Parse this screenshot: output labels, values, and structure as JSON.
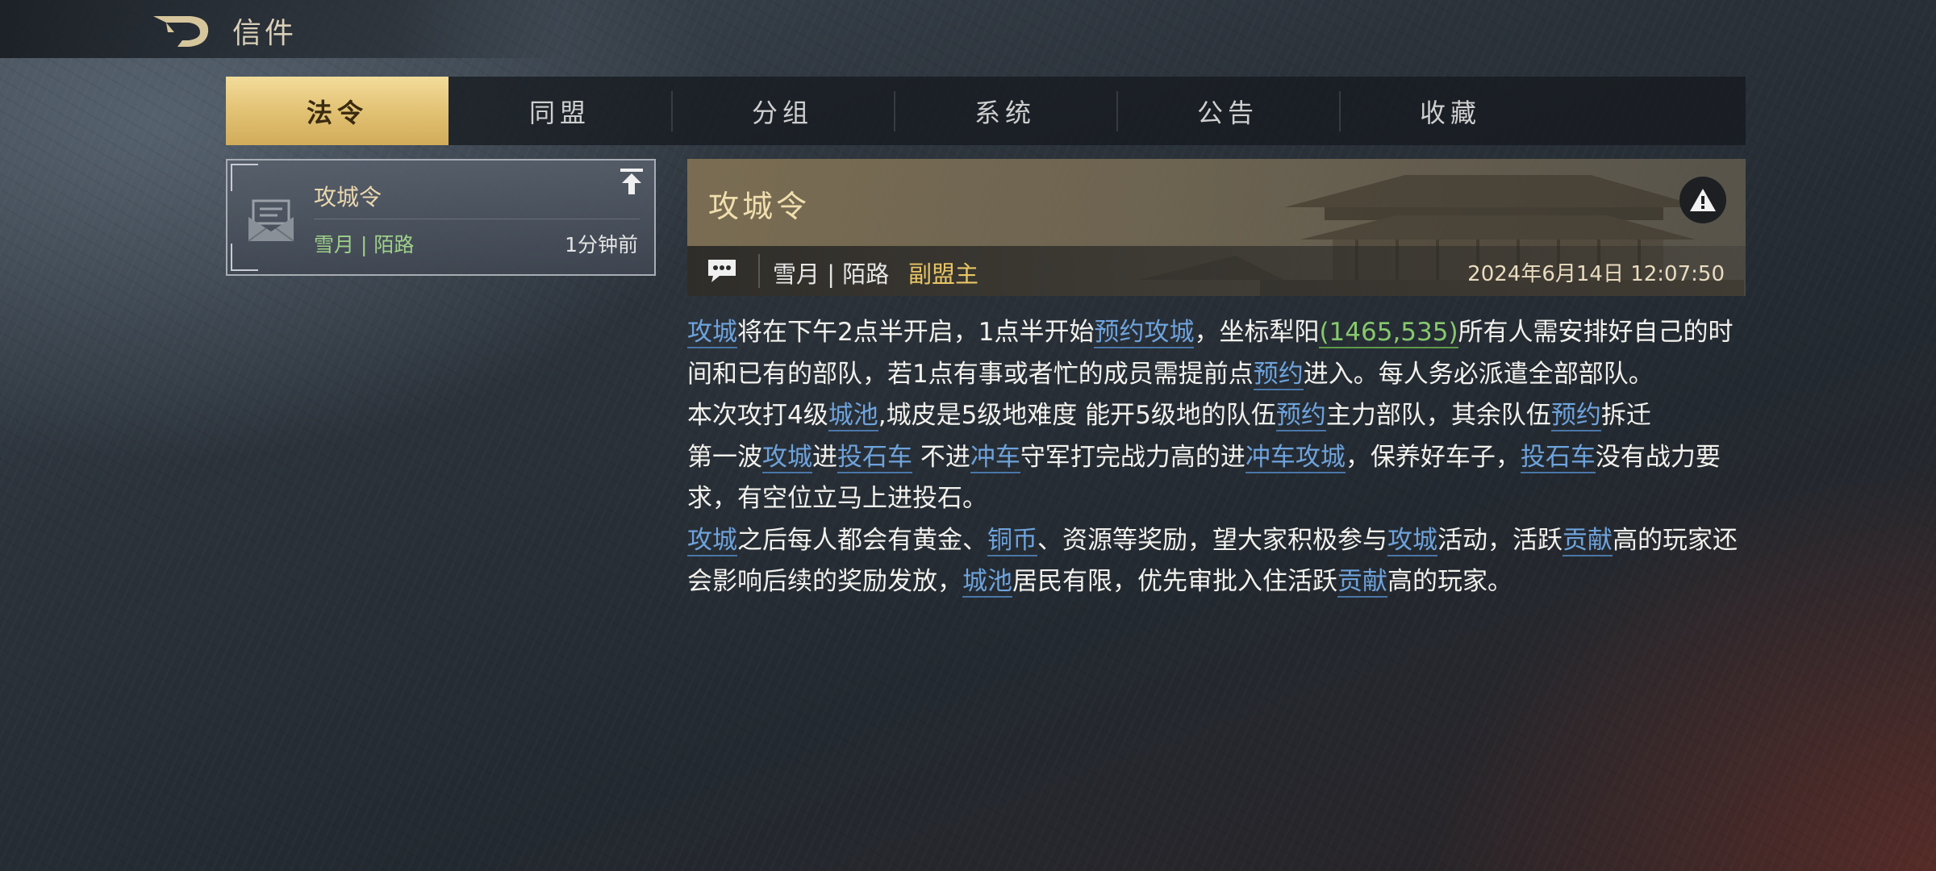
{
  "header": {
    "title": "信件"
  },
  "tabs": [
    {
      "label": "法令",
      "active": true
    },
    {
      "label": "同盟",
      "active": false
    },
    {
      "label": "分组",
      "active": false
    },
    {
      "label": "系统",
      "active": false
    },
    {
      "label": "公告",
      "active": false
    },
    {
      "label": "收藏",
      "active": false
    }
  ],
  "mail_list": [
    {
      "title": "攻城令",
      "sender": "雪月 | 陌路",
      "time": "1分钟前",
      "icon": "envelope-icon",
      "pinned": true
    }
  ],
  "detail": {
    "title": "攻城令",
    "sender": "雪月 | 陌路",
    "role": "副盟主",
    "datetime": "2024年6月14日 12:07:50",
    "paragraphs": [
      [
        {
          "t": "攻城",
          "k": "kw"
        },
        {
          "t": "将在下午2点半开启，1点半开始"
        },
        {
          "t": "预约攻城",
          "k": "kw"
        },
        {
          "t": "，坐标犁阳"
        },
        {
          "t": "(1465,535)",
          "k": "coord"
        },
        {
          "t": "所有人需安排好自己的时间和已有的部队，若1点有事或者忙的成员需提前点"
        },
        {
          "t": "预约",
          "k": "kw"
        },
        {
          "t": "进入。每人务必派遣全部部队。"
        }
      ],
      [
        {
          "t": "本次攻打4级"
        },
        {
          "t": "城池",
          "k": "kw"
        },
        {
          "t": ",城皮是5级地难度 能开5级地的队伍"
        },
        {
          "t": "预约",
          "k": "kw"
        },
        {
          "t": "主力部队，其余队伍"
        },
        {
          "t": "预约",
          "k": "kw"
        },
        {
          "t": "拆迁"
        }
      ],
      [
        {
          "t": "第一波"
        },
        {
          "t": "攻城",
          "k": "kw"
        },
        {
          "t": "进"
        },
        {
          "t": "投石车",
          "k": "kw"
        },
        {
          "t": " 不进"
        },
        {
          "t": "冲车",
          "k": "kw"
        },
        {
          "t": "守军打完战力高的进"
        },
        {
          "t": "冲车攻城",
          "k": "kw"
        },
        {
          "t": "，保养好车子，"
        },
        {
          "t": "投石车",
          "k": "kw"
        },
        {
          "t": "没有战力要求，有空位立马上进投石。"
        }
      ],
      [
        {
          "t": "攻城",
          "k": "kw"
        },
        {
          "t": "之后每人都会有黄金、"
        },
        {
          "t": "铜币",
          "k": "kw"
        },
        {
          "t": "、资源等奖励，望大家积极参与"
        },
        {
          "t": "攻城",
          "k": "kw"
        },
        {
          "t": "活动，活跃"
        },
        {
          "t": "贡献",
          "k": "kw"
        },
        {
          "t": "高的玩家还会影响后续的奖励发放，"
        },
        {
          "t": "城池",
          "k": "kw"
        },
        {
          "t": "居民有限，优先审批入住活跃"
        },
        {
          "t": "贡献",
          "k": "kw"
        },
        {
          "t": "高的玩家。"
        }
      ]
    ]
  },
  "colors": {
    "tab_active_bg": "#e2c274",
    "keyword_link": "#6ea3dc",
    "coordinate_link": "#87c96e",
    "sender_green": "#9ed08a",
    "role_gold": "#e8c565"
  }
}
